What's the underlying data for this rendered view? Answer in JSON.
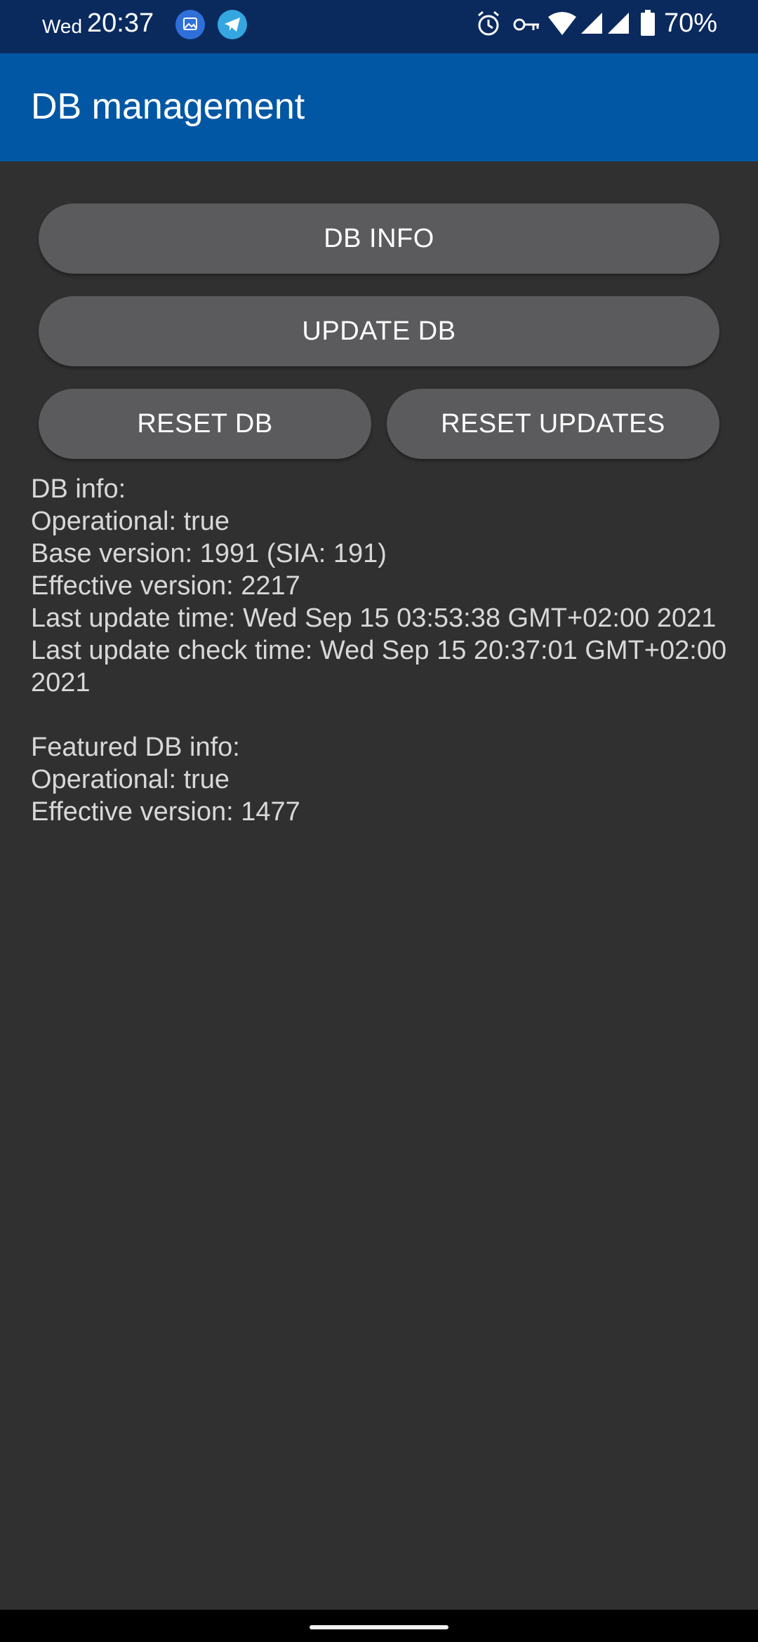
{
  "status_bar": {
    "day": "Wed",
    "time": "20:37",
    "battery": "70%",
    "notification_icons": [
      "gallery-icon",
      "telegram-icon"
    ],
    "system_icons": [
      "alarm-icon",
      "vpn-key-icon",
      "wifi-icon",
      "signal-icon",
      "signal-icon",
      "battery-icon"
    ]
  },
  "app_bar": {
    "title": "DB management",
    "color": "#0157a3"
  },
  "buttons": {
    "db_info": "DB INFO",
    "update_db": "UPDATE DB",
    "reset_db": "RESET DB",
    "reset_updates": "RESET UPDATES"
  },
  "db_info": {
    "heading": "DB info:",
    "operational": "Operational: true",
    "base_version": "Base version: 1991 (SIA: 191)",
    "effective_version": "Effective version: 2217",
    "last_update_time": "Last update time: Wed Sep 15 03:53:38 GMT+02:00 2021",
    "last_update_check_time": "Last update check time: Wed Sep 15 20:37:01 GMT+02:00 2021"
  },
  "featured_db_info": {
    "heading": "Featured DB info:",
    "operational": "Operational: true",
    "effective_version": "Effective version: 1477"
  },
  "colors": {
    "background": "#303030",
    "button": "#5b5b5d",
    "status_bar": "#0a2a5e",
    "text": "#d8d8d8"
  }
}
